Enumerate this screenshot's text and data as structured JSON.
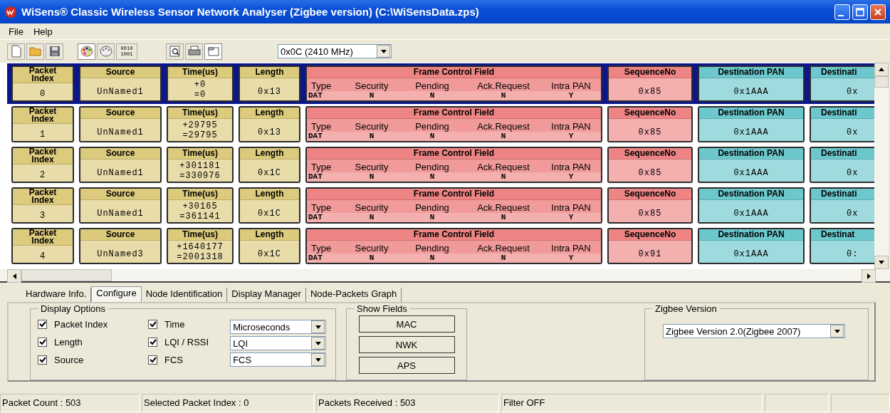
{
  "window": {
    "title": "WiSens® Classic Wireless Sensor Network Analyser (Zigbee version) (C:\\WiSensData.zps)"
  },
  "menu": [
    "File",
    "Help"
  ],
  "toolbar": {
    "binary_icon_lines": [
      "0010",
      "1001"
    ],
    "channel": "0x0C (2410 MHz)"
  },
  "packets": [
    {
      "selected": true,
      "fields": [
        {
          "kind": "value",
          "header": "Packet Index",
          "value": "0",
          "color": "#dccb7c"
        },
        {
          "kind": "value",
          "header": "Source",
          "value": "UnNamed1",
          "color": "#dccb7c"
        },
        {
          "kind": "time",
          "header": "Time(us)",
          "values": [
            "+0",
            "=0"
          ],
          "color": "#dccb7c"
        },
        {
          "kind": "value",
          "header": "Length",
          "value": "0x13",
          "color": "#dccb7c"
        },
        {
          "kind": "frame",
          "header": "Frame Control Field",
          "color": "#ee8484",
          "subfields": [
            {
              "label": "Type",
              "value": "DAT"
            },
            {
              "label": "Security",
              "value": "N"
            },
            {
              "label": "Pending",
              "value": "N"
            },
            {
              "label": "Ack.Request",
              "value": "N"
            },
            {
              "label": "Intra PAN",
              "value": "Y"
            }
          ]
        },
        {
          "kind": "value",
          "header": "SequenceNo",
          "value": "0x85",
          "color": "#ee8484"
        },
        {
          "kind": "value",
          "header": "Destination PAN",
          "value": "0x1AAA",
          "color": "#6cc8cc"
        },
        {
          "kind": "value",
          "header": "Destinati",
          "value": "0x",
          "color": "#6cc8cc"
        }
      ]
    },
    {
      "selected": false,
      "fields": [
        {
          "kind": "value",
          "header": "Packet Index",
          "value": "1",
          "color": "#dccb7c"
        },
        {
          "kind": "value",
          "header": "Source",
          "value": "UnNamed1",
          "color": "#dccb7c"
        },
        {
          "kind": "time",
          "header": "Time(us)",
          "values": [
            "+29795",
            "=29795"
          ],
          "color": "#dccb7c"
        },
        {
          "kind": "value",
          "header": "Length",
          "value": "0x13",
          "color": "#dccb7c"
        },
        {
          "kind": "frame",
          "header": "Frame Control Field",
          "color": "#ee8484",
          "subfields": [
            {
              "label": "Type",
              "value": "DAT"
            },
            {
              "label": "Security",
              "value": "N"
            },
            {
              "label": "Pending",
              "value": "N"
            },
            {
              "label": "Ack.Request",
              "value": "N"
            },
            {
              "label": "Intra PAN",
              "value": "Y"
            }
          ]
        },
        {
          "kind": "value",
          "header": "SequenceNo",
          "value": "0x85",
          "color": "#ee8484"
        },
        {
          "kind": "value",
          "header": "Destination PAN",
          "value": "0x1AAA",
          "color": "#6cc8cc"
        },
        {
          "kind": "value",
          "header": "Destinati",
          "value": "0x",
          "color": "#6cc8cc"
        }
      ]
    },
    {
      "selected": false,
      "fields": [
        {
          "kind": "value",
          "header": "Packet Index",
          "value": "2",
          "color": "#dccb7c"
        },
        {
          "kind": "value",
          "header": "Source",
          "value": "UnNamed1",
          "color": "#dccb7c"
        },
        {
          "kind": "time",
          "header": "Time(us)",
          "values": [
            "+301181",
            "=330976"
          ],
          "color": "#dccb7c"
        },
        {
          "kind": "value",
          "header": "Length",
          "value": "0x1C",
          "color": "#dccb7c"
        },
        {
          "kind": "frame",
          "header": "Frame Control Field",
          "color": "#ee8484",
          "subfields": [
            {
              "label": "Type",
              "value": "DAT"
            },
            {
              "label": "Security",
              "value": "N"
            },
            {
              "label": "Pending",
              "value": "N"
            },
            {
              "label": "Ack.Request",
              "value": "N"
            },
            {
              "label": "Intra PAN",
              "value": "Y"
            }
          ]
        },
        {
          "kind": "value",
          "header": "SequenceNo",
          "value": "0x85",
          "color": "#ee8484"
        },
        {
          "kind": "value",
          "header": "Destination PAN",
          "value": "0x1AAA",
          "color": "#6cc8cc"
        },
        {
          "kind": "value",
          "header": "Destinati",
          "value": "0x",
          "color": "#6cc8cc"
        }
      ]
    },
    {
      "selected": false,
      "fields": [
        {
          "kind": "value",
          "header": "Packet Index",
          "value": "3",
          "color": "#dccb7c"
        },
        {
          "kind": "value",
          "header": "Source",
          "value": "UnNamed1",
          "color": "#dccb7c"
        },
        {
          "kind": "time",
          "header": "Time(us)",
          "values": [
            "+30165",
            "=361141"
          ],
          "color": "#dccb7c"
        },
        {
          "kind": "value",
          "header": "Length",
          "value": "0x1C",
          "color": "#dccb7c"
        },
        {
          "kind": "frame",
          "header": "Frame Control Field",
          "color": "#ee8484",
          "subfields": [
            {
              "label": "Type",
              "value": "DAT"
            },
            {
              "label": "Security",
              "value": "N"
            },
            {
              "label": "Pending",
              "value": "N"
            },
            {
              "label": "Ack.Request",
              "value": "N"
            },
            {
              "label": "Intra PAN",
              "value": "Y"
            }
          ]
        },
        {
          "kind": "value",
          "header": "SequenceNo",
          "value": "0x85",
          "color": "#ee8484"
        },
        {
          "kind": "value",
          "header": "Destination PAN",
          "value": "0x1AAA",
          "color": "#6cc8cc"
        },
        {
          "kind": "value",
          "header": "Destinati",
          "value": "0x",
          "color": "#6cc8cc"
        }
      ]
    },
    {
      "selected": false,
      "fields": [
        {
          "kind": "value",
          "header": "Packet Index",
          "value": "4",
          "color": "#dccb7c"
        },
        {
          "kind": "value",
          "header": "Source",
          "value": "UnNamed3",
          "color": "#dccb7c"
        },
        {
          "kind": "time",
          "header": "Time(us)",
          "values": [
            "+1640177",
            "=2001318"
          ],
          "color": "#dccb7c"
        },
        {
          "kind": "value",
          "header": "Length",
          "value": "0x1C",
          "color": "#dccb7c"
        },
        {
          "kind": "frame",
          "header": "Frame Control Field",
          "color": "#ee8484",
          "subfields": [
            {
              "label": "Type",
              "value": "DAT"
            },
            {
              "label": "Security",
              "value": "N"
            },
            {
              "label": "Pending",
              "value": "N"
            },
            {
              "label": "Ack.Request",
              "value": "N"
            },
            {
              "label": "Intra PAN",
              "value": "Y"
            }
          ]
        },
        {
          "kind": "value",
          "header": "SequenceNo",
          "value": "0x91",
          "color": "#ee8484"
        },
        {
          "kind": "value",
          "header": "Destination PAN",
          "value": "0x1AAA",
          "color": "#6cc8cc"
        },
        {
          "kind": "value",
          "header": "Destinat",
          "value": "0:",
          "color": "#6cc8cc"
        }
      ]
    }
  ],
  "tabs": [
    {
      "label": "Hardware Info.",
      "selected": false
    },
    {
      "label": "Configure",
      "selected": true
    },
    {
      "label": "Node Identification",
      "selected": false
    },
    {
      "label": "Display Manager",
      "selected": false
    },
    {
      "label": "Node-Packets Graph",
      "selected": false
    }
  ],
  "display_options": {
    "title": "Display Options",
    "checkboxes": [
      {
        "label": "Packet Index",
        "checked": true
      },
      {
        "label": "Length",
        "checked": true
      },
      {
        "label": "Source",
        "checked": true
      },
      {
        "label": "Time",
        "checked": true
      },
      {
        "label": "LQI / RSSI",
        "checked": true
      },
      {
        "label": "FCS",
        "checked": true
      }
    ],
    "dropdowns": [
      "Microseconds",
      "LQI",
      "FCS"
    ]
  },
  "show_fields": {
    "title": "Show Fields",
    "buttons": [
      "MAC",
      "NWK",
      "APS"
    ]
  },
  "zigbee_version": {
    "title": "Zigbee Version",
    "value": "Zigbee Version 2.0(Zigbee 2007)"
  },
  "status_bar": [
    "Packet Count : 503",
    "Selected Packet Index : 0",
    "Packets Received : 503",
    "Filter OFF"
  ]
}
